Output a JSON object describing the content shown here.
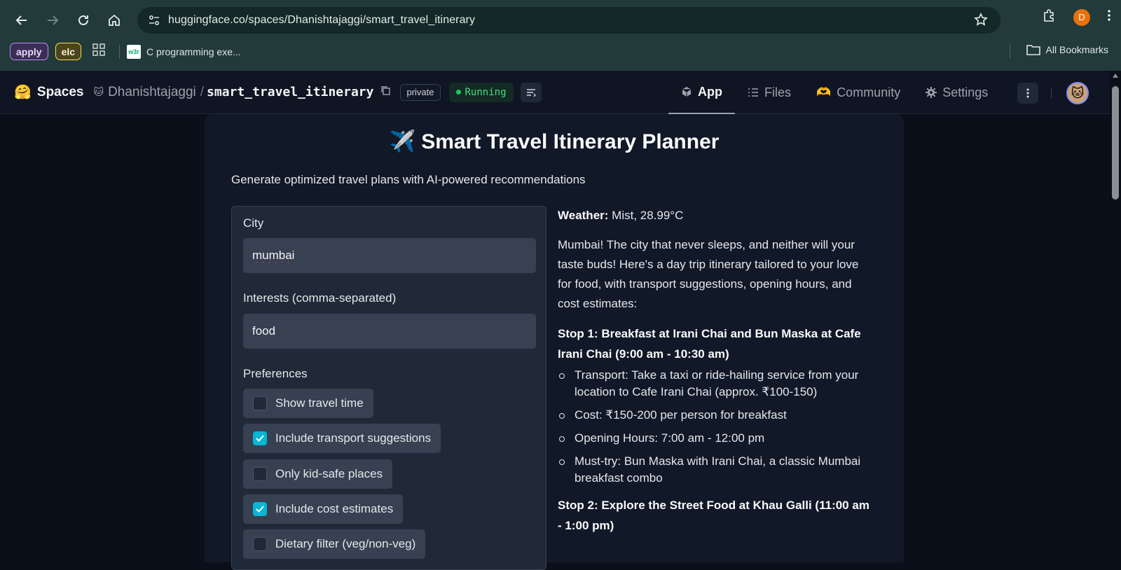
{
  "browser": {
    "url": "huggingface.co/spaces/Dhanishtajaggi/smart_travel_itinerary",
    "profile_initial": "D",
    "bookmarks": [
      {
        "label": "apply"
      },
      {
        "label": "elc"
      }
    ],
    "bookmark_w3_icon": "w3r",
    "bookmark_link": "C programming exe...",
    "all_bookmarks": "All Bookmarks"
  },
  "hf_header": {
    "brand": "Spaces",
    "owner": "Dhanishtajaggi",
    "separator": "/",
    "repo": "smart_travel_itinerary",
    "visibility": "private",
    "status": "Running",
    "tabs": [
      {
        "label": "App",
        "icon": "cube-icon"
      },
      {
        "label": "Files",
        "icon": "files-icon"
      },
      {
        "label": "Community",
        "icon": "community-icon"
      },
      {
        "label": "Settings",
        "icon": "gear-icon"
      }
    ]
  },
  "app": {
    "title": "✈️ Smart Travel Itinerary Planner",
    "description": "Generate optimized travel plans with AI-powered recommendations",
    "form": {
      "city_label": "City",
      "city_value": "mumbai",
      "interests_label": "Interests (comma-separated)",
      "interests_value": "food",
      "preferences_label": "Preferences",
      "preferences": [
        {
          "label": "Show travel time",
          "checked": false
        },
        {
          "label": "Include transport suggestions",
          "checked": true
        },
        {
          "label": "Only kid-safe places",
          "checked": false
        },
        {
          "label": "Include cost estimates",
          "checked": true
        },
        {
          "label": "Dietary filter (veg/non-veg)",
          "checked": false
        }
      ]
    },
    "output": {
      "weather_label": "Weather:",
      "weather_value": " Mist, 28.99°C",
      "intro": "Mumbai! The city that never sleeps, and neither will your taste buds! Here's a day trip itinerary tailored to your love for food, with transport suggestions, opening hours, and cost estimates:",
      "stops": [
        {
          "heading": "Stop 1: Breakfast at Irani Chai and Bun Maska at Cafe Irani Chai (9:00 am - 10:30 am)",
          "items": [
            "Transport: Take a taxi or ride-hailing service from your location to Cafe Irani Chai (approx. ₹100-150)",
            "Cost: ₹150-200 per person for breakfast",
            "Opening Hours: 7:00 am - 12:00 pm",
            "Must-try: Bun Maska with Irani Chai, a classic Mumbai breakfast combo"
          ]
        },
        {
          "heading": "Stop 2: Explore the Street Food at Khau Galli (11:00 am - 1:00 pm)",
          "items": []
        }
      ]
    }
  }
}
